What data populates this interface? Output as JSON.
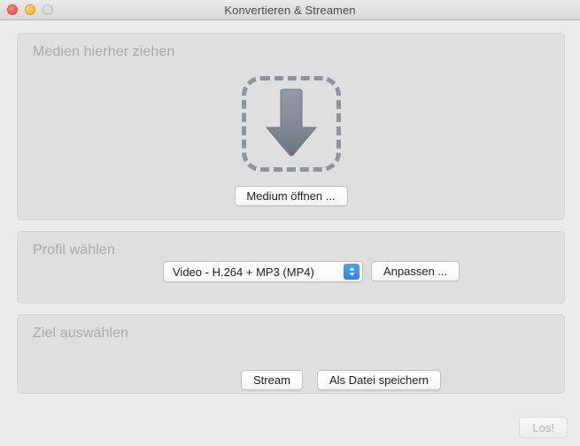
{
  "window": {
    "title": "Konvertieren & Streamen",
    "traffic_lights": [
      {
        "name": "close",
        "color": "#ff5f57",
        "enabled": true
      },
      {
        "name": "minimize",
        "color": "#ffbd2e",
        "enabled": true
      },
      {
        "name": "zoom",
        "color": "#d6d6d6",
        "enabled": false
      }
    ]
  },
  "panels": {
    "drop": {
      "title": "Medien hierher ziehen",
      "dropzone_icon": "down-arrow-icon",
      "open_button": "Medium öffnen ..."
    },
    "profile": {
      "title": "Profil wählen",
      "selected_profile": "Video - H.264 + MP3 (MP4)",
      "stepper_icon": "up-down-chevron-icon",
      "customize_button": "Anpassen ..."
    },
    "destination": {
      "title": "Ziel auswählen",
      "stream_button": "Stream",
      "save_button": "Als Datei speichern"
    }
  },
  "footer": {
    "go_button": "Los!",
    "go_enabled": false
  },
  "colors": {
    "window_bg": "#ececec",
    "panel_bg": "#dfdfdf",
    "panel_title": "#a9a9a9",
    "accent_blue": "#2f81e4",
    "arrow_gray": "#7d8490",
    "dashed_border": "#8d94a0"
  }
}
